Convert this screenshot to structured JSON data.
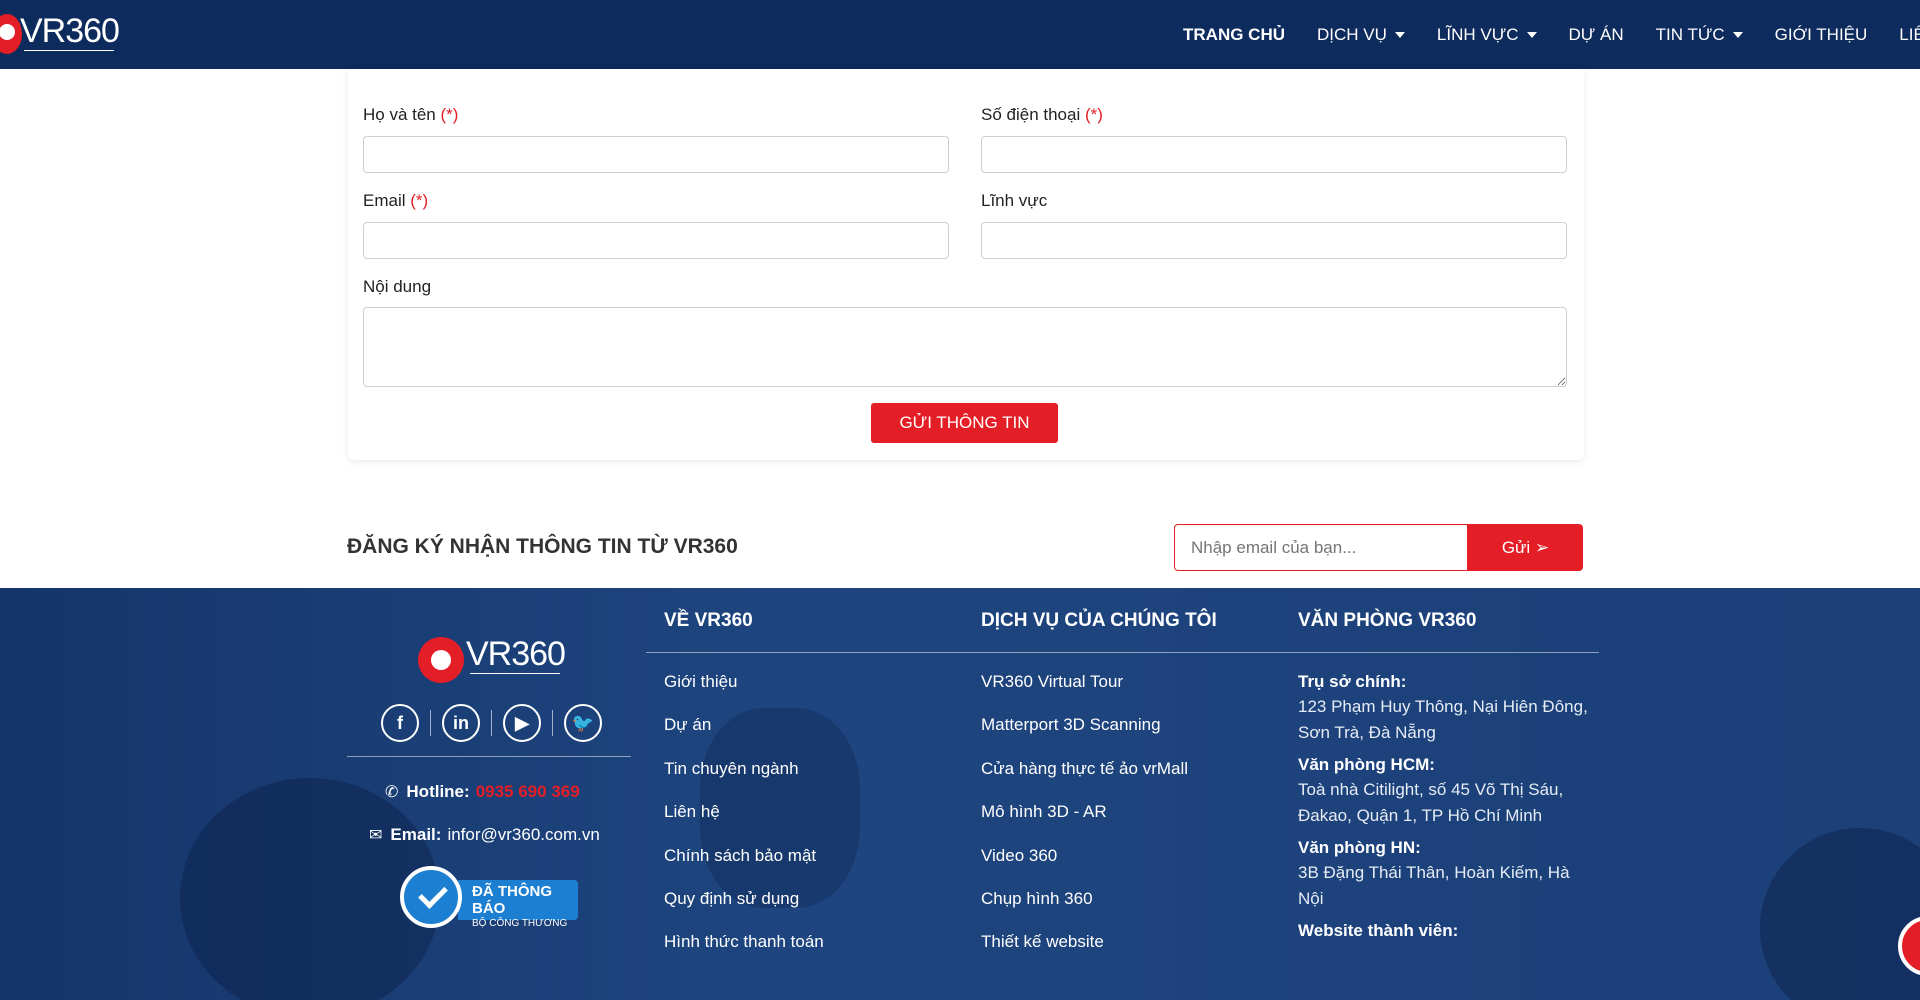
{
  "header": {
    "logo_text": "VR360",
    "nav": [
      {
        "label": "TRANG CHỦ",
        "active": true,
        "dropdown": false
      },
      {
        "label": "DỊCH VỤ",
        "active": false,
        "dropdown": true
      },
      {
        "label": "LĨNH VỰC",
        "active": false,
        "dropdown": true
      },
      {
        "label": "DỰ ÁN",
        "active": false,
        "dropdown": false
      },
      {
        "label": "TIN TỨC",
        "active": false,
        "dropdown": true
      },
      {
        "label": "GIỚI THIỆU",
        "active": false,
        "dropdown": false
      },
      {
        "label": "LIÊN",
        "active": false,
        "dropdown": false
      }
    ]
  },
  "form": {
    "name_label": "Họ và tên",
    "phone_label": "Số điện thoại",
    "email_label": "Email",
    "field_label": "Lĩnh vực",
    "content_label": "Nội dung",
    "required_mark": "(*)",
    "name_value": "",
    "phone_value": "",
    "email_value": "",
    "field_value": "",
    "content_value": "",
    "submit_label": "GỬI THÔNG TIN"
  },
  "newsletter": {
    "title": "ĐĂNG KÝ NHẬN THÔNG TIN TỪ VR360",
    "placeholder": "Nhập email của bạn...",
    "button_label": "Gửi"
  },
  "footer": {
    "logo_text": "VR360",
    "socials": [
      "f",
      "in",
      "▶",
      "🐦"
    ],
    "hotline_label": "Hotline:",
    "hotline_value": "0935 690 369",
    "email_label": "Email:",
    "email_value": "infor@vr360.com.vn",
    "badge_line1": "ĐÃ THÔNG BÁO",
    "badge_line2": "BỘ CÔNG THƯƠNG",
    "about": {
      "title": "VỀ VR360",
      "items": [
        "Giới thiệu",
        "Dự án",
        "Tin chuyên ngành",
        "Liên hệ",
        "Chính sách bảo mật",
        "Quy định sử dụng",
        "Hình thức thanh toán"
      ]
    },
    "services": {
      "title": "DỊCH VỤ CỦA CHÚNG TÔI",
      "items": [
        "VR360 Virtual Tour",
        "Matterport 3D Scanning",
        "Cửa hàng thực tế ảo vrMall",
        "Mô hình 3D - AR",
        "Video 360",
        "Chụp hình 360",
        "Thiết kế website"
      ]
    },
    "offices": {
      "title": "VĂN PHÒNG VR360",
      "blocks": [
        {
          "head": "Trụ sở chính:",
          "addr": "123 Phạm Huy Thông, Nại Hiên Đông, Sơn Trà, Đà Nẵng"
        },
        {
          "head": "Văn phòng HCM:",
          "addr": "Toà nhà Citilight, số 45 Võ Thị Sáu, Đakao, Quận 1, TP Hồ Chí Minh"
        },
        {
          "head": "Văn phòng HN:",
          "addr": "3B Đặng Thái Thân, Hoàn Kiếm, Hà Nội"
        },
        {
          "head": "Website thành viên:",
          "addr": ""
        }
      ]
    }
  },
  "colors": {
    "header_bg": "#0d2b5c",
    "accent_red": "#e41e26",
    "footer_bg": "#1a3d77"
  }
}
